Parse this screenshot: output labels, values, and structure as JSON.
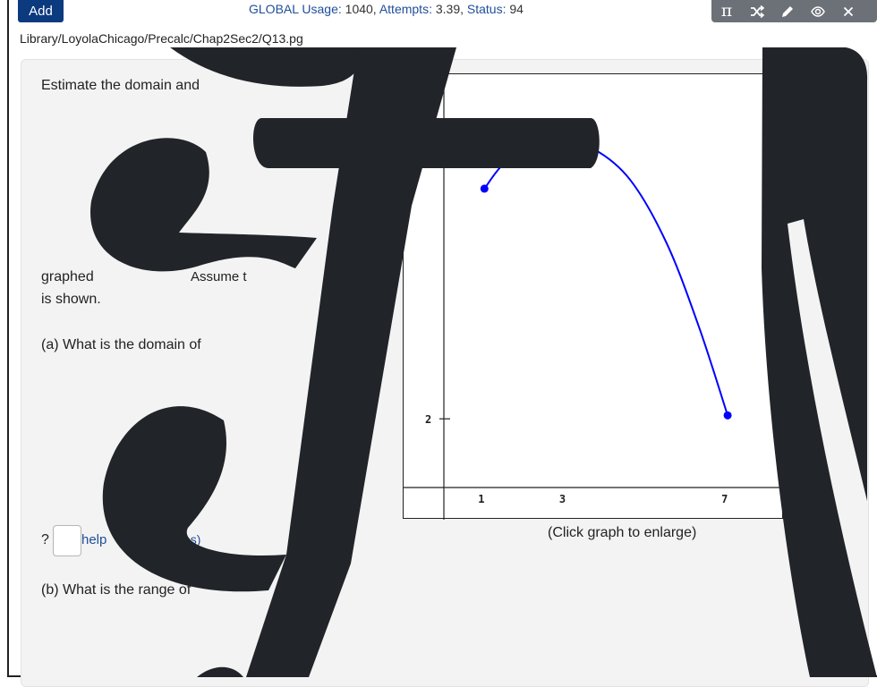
{
  "header": {
    "add_label": "Add",
    "usage_label": "GLOBAL Usage:",
    "usage_value": "1040,",
    "attempts_label": "Attempts:",
    "attempts_value": "3.39,",
    "status_label": "Status:",
    "status_value": "94"
  },
  "toolbar": {
    "pi_symbol": "π",
    "icons": [
      "shuffle-icon",
      "pencil-icon",
      "eye-icon",
      "close-icon"
    ]
  },
  "file_path": "Library/LoyolaChicago/Precalc/Chap2Sec2/Q13.pg",
  "problem": {
    "intro_fragment": "Estimate the domain and",
    "graphed_fragment": "graphed",
    "assume_fragment": "Assume t",
    "shown_text": "is shown.",
    "part_a": "(a) What is the domain of",
    "question_mark": "?",
    "help_link": "help",
    "help_suffix": "es)",
    "part_b": "(b) What is the range of"
  },
  "graph": {
    "caption": "(Click graph to enlarge)",
    "x_ticks": [
      "1",
      "3",
      "7"
    ],
    "y_ticks": [
      "2"
    ]
  },
  "chart_data": {
    "type": "line",
    "x_tick_labels": [
      "1",
      "3",
      "7"
    ],
    "y_tick_labels": [
      "2"
    ],
    "series": [
      {
        "x": [
          1,
          1.5,
          2.2,
          3,
          3.7,
          4.6,
          5.5,
          6.3,
          7
        ],
        "y": [
          8.7,
          9.45,
          9.85,
          10.0,
          9.85,
          8.95,
          7.1,
          4.65,
          2.1
        ],
        "color": "#0000ff",
        "endpoints": "closed"
      }
    ]
  },
  "colors": {
    "add_button": "#0b3a7e",
    "link": "#1f4e9a",
    "toolbar": "#6c7178",
    "curve": "#0000ff",
    "overlay_glyph": "#212428"
  }
}
